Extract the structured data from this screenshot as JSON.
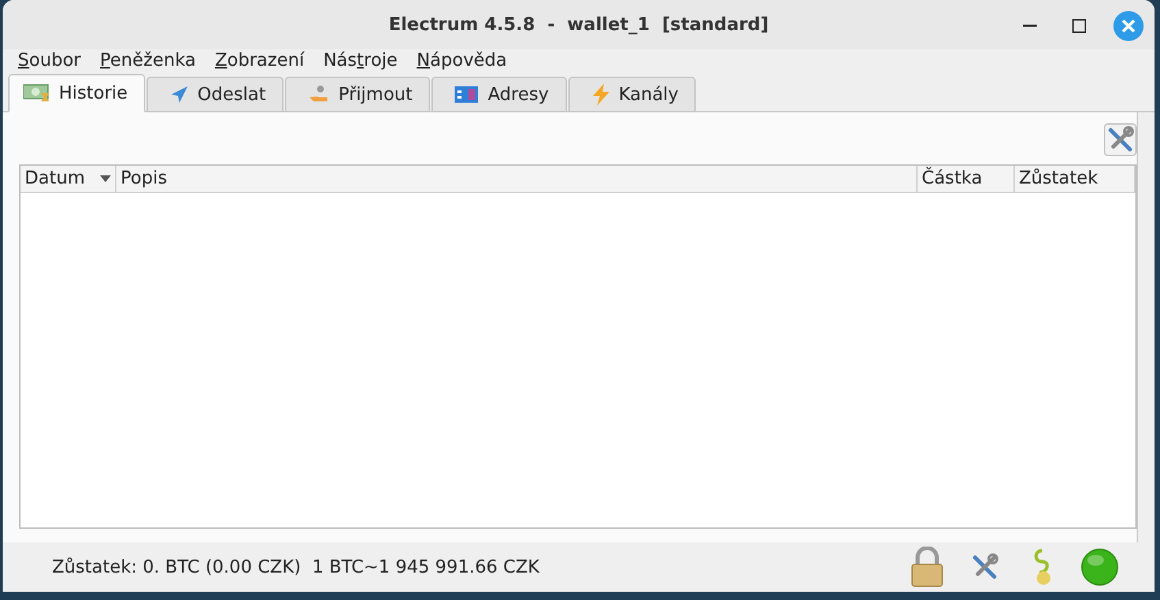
{
  "window": {
    "title": "Electrum 4.5.8  -  wallet_1  [standard]"
  },
  "menu": [
    {
      "access_key": "S",
      "after": "oubor"
    },
    {
      "access_key": "P",
      "after": "eněženka"
    },
    {
      "access_key": "Z",
      "after": "obrazení"
    },
    {
      "before": "Nás",
      "access_key": "t",
      "after": "roje"
    },
    {
      "access_key": "N",
      "after": "ápověda"
    }
  ],
  "tabs": [
    {
      "label": "Historie",
      "kind": "history",
      "selected": true
    },
    {
      "label": "Odeslat",
      "kind": "send",
      "selected": false
    },
    {
      "label": "Přijmout",
      "kind": "receive",
      "selected": false
    },
    {
      "label": "Adresy",
      "kind": "addresses",
      "selected": false
    },
    {
      "label": "Kanály",
      "kind": "channels",
      "selected": false
    }
  ],
  "table": {
    "columns": [
      {
        "label": "Datum",
        "sorted": true
      },
      {
        "label": "Popis",
        "sorted": false
      },
      {
        "label": "Částka",
        "sorted": false
      },
      {
        "label": "Zůstatek",
        "sorted": false
      }
    ]
  },
  "status_bar": {
    "balance": "Zůstatek: 0. BTC (0.00 CZK)  1 BTC~1 945 991.66 CZK",
    "connected": true
  }
}
